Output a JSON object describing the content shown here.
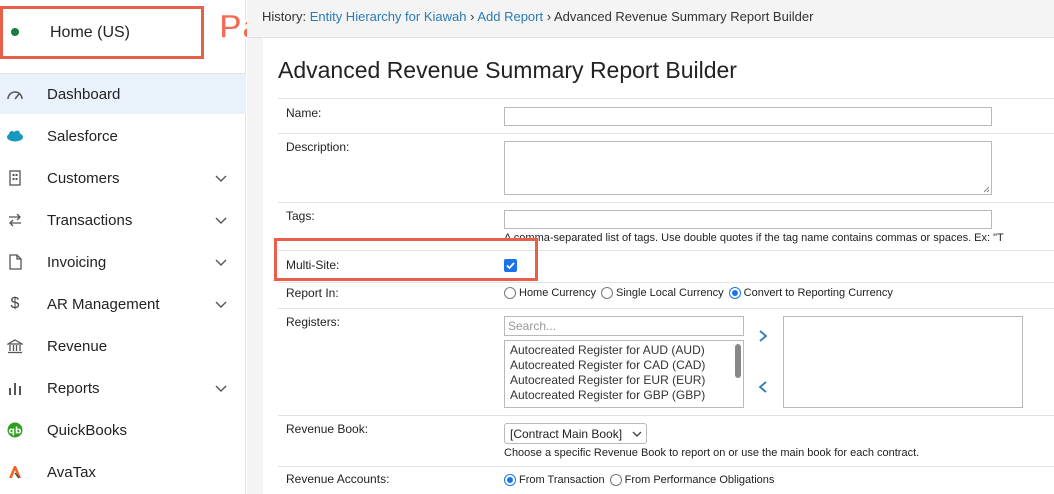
{
  "sidebar": {
    "entity": "Home (US)",
    "annotation": "Parent",
    "items": [
      {
        "label": "Dashboard",
        "icon": "gauge-icon",
        "active": true,
        "expandable": false
      },
      {
        "label": "Salesforce",
        "icon": "salesforce-cloud-icon",
        "active": false,
        "expandable": false
      },
      {
        "label": "Customers",
        "icon": "building-icon",
        "active": false,
        "expandable": true
      },
      {
        "label": "Transactions",
        "icon": "swap-arrows-icon",
        "active": false,
        "expandable": true
      },
      {
        "label": "Invoicing",
        "icon": "document-icon",
        "active": false,
        "expandable": true
      },
      {
        "label": "AR Management",
        "icon": "dollar-icon",
        "active": false,
        "expandable": true
      },
      {
        "label": "Revenue",
        "icon": "bank-icon",
        "active": false,
        "expandable": false
      },
      {
        "label": "Reports",
        "icon": "bar-chart-icon",
        "active": false,
        "expandable": true
      },
      {
        "label": "QuickBooks",
        "icon": "quickbooks-icon",
        "active": false,
        "expandable": false
      },
      {
        "label": "AvaTax",
        "icon": "avatax-icon",
        "active": false,
        "expandable": false
      }
    ]
  },
  "breadcrumb": {
    "prefix": "History:",
    "link1": "Entity Hierarchy for Kiawah",
    "sep": "›",
    "link2": "Add Report",
    "current": "Advanced Revenue Summary Report Builder"
  },
  "page": {
    "title": "Advanced Revenue Summary Report Builder"
  },
  "form": {
    "name_label": "Name:",
    "name_value": "",
    "description_label": "Description:",
    "description_value": "",
    "tags_label": "Tags:",
    "tags_value": "",
    "tags_hint": "A comma-separated list of tags. Use double quotes if the tag name contains commas or spaces. Ex: \"T",
    "multisite_label": "Multi-Site:",
    "multisite_checked": true,
    "report_in_label": "Report In:",
    "report_in_options": [
      "Home Currency",
      "Single Local Currency",
      "Convert to Reporting Currency"
    ],
    "report_in_selected": "Convert to Reporting Currency",
    "registers_label": "Registers:",
    "registers_search_placeholder": "Search...",
    "registers_available": [
      "Autocreated Register for AUD (AUD)",
      "Autocreated Register for CAD (CAD)",
      "Autocreated Register for EUR (EUR)",
      "Autocreated Register for GBP (GBP)"
    ],
    "revenue_book_label": "Revenue Book:",
    "revenue_book_value": "[Contract Main Book]",
    "revenue_book_hint": "Choose a specific Revenue Book to report on or use the main book for each contract.",
    "revenue_accounts_label": "Revenue Accounts:",
    "revenue_accounts_options": [
      "From Transaction",
      "From Performance Obligations"
    ],
    "revenue_accounts_selected": "From Transaction"
  },
  "colors": {
    "accent": "#1a73e8",
    "link": "#2a7ab6",
    "highlight": "#e8604a",
    "active_nav": "#e9f2fb"
  }
}
